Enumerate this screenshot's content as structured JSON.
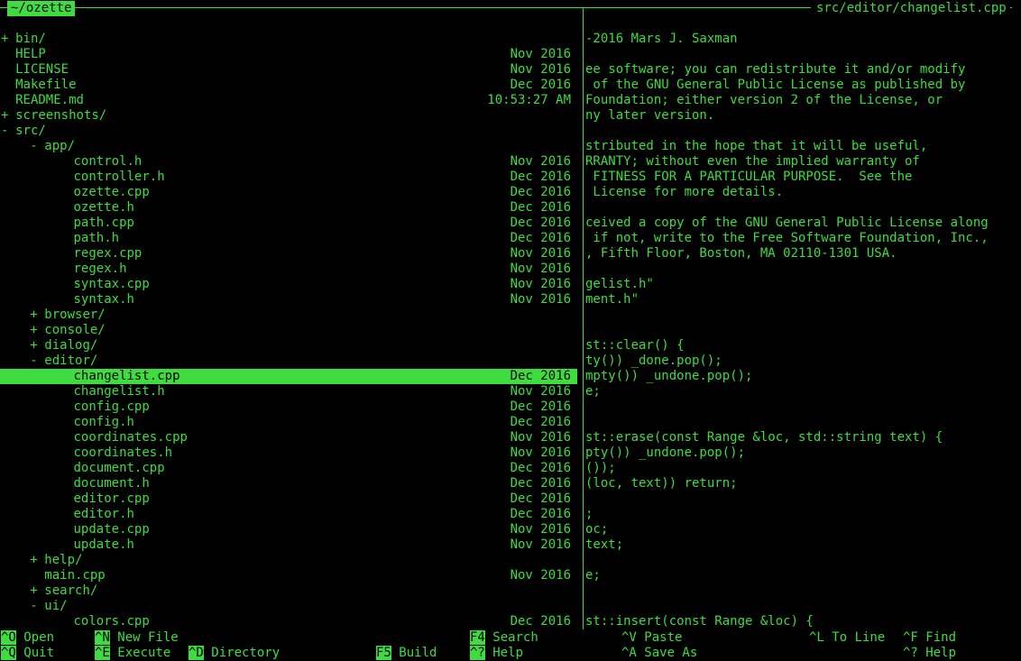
{
  "left_title": "~/ozette",
  "right_title": "src/editor/changelist.cpp",
  "tree": [
    {
      "mark": "+",
      "name": "bin/",
      "date": "",
      "depth": 0
    },
    {
      "mark": "",
      "name": "HELP",
      "date": "Nov 2016",
      "depth": 0
    },
    {
      "mark": "",
      "name": "LICENSE",
      "date": "Nov 2016",
      "depth": 0
    },
    {
      "mark": "",
      "name": "Makefile",
      "date": "Dec 2016",
      "depth": 0
    },
    {
      "mark": "",
      "name": "README.md",
      "date": "10:53:27 AM",
      "depth": 0
    },
    {
      "mark": "+",
      "name": "screenshots/",
      "date": "",
      "depth": 0
    },
    {
      "mark": "-",
      "name": "src/",
      "date": "",
      "depth": 0
    },
    {
      "mark": "-",
      "name": "app/",
      "date": "",
      "depth": 1
    },
    {
      "mark": "",
      "name": "control.h",
      "date": "Nov 2016",
      "depth": 2
    },
    {
      "mark": "",
      "name": "controller.h",
      "date": "Dec 2016",
      "depth": 2
    },
    {
      "mark": "",
      "name": "ozette.cpp",
      "date": "Dec 2016",
      "depth": 2
    },
    {
      "mark": "",
      "name": "ozette.h",
      "date": "Dec 2016",
      "depth": 2
    },
    {
      "mark": "",
      "name": "path.cpp",
      "date": "Dec 2016",
      "depth": 2
    },
    {
      "mark": "",
      "name": "path.h",
      "date": "Dec 2016",
      "depth": 2
    },
    {
      "mark": "",
      "name": "regex.cpp",
      "date": "Nov 2016",
      "depth": 2
    },
    {
      "mark": "",
      "name": "regex.h",
      "date": "Nov 2016",
      "depth": 2
    },
    {
      "mark": "",
      "name": "syntax.cpp",
      "date": "Nov 2016",
      "depth": 2
    },
    {
      "mark": "",
      "name": "syntax.h",
      "date": "Nov 2016",
      "depth": 2
    },
    {
      "mark": "+",
      "name": "browser/",
      "date": "",
      "depth": 1
    },
    {
      "mark": "+",
      "name": "console/",
      "date": "",
      "depth": 1
    },
    {
      "mark": "+",
      "name": "dialog/",
      "date": "",
      "depth": 1
    },
    {
      "mark": "-",
      "name": "editor/",
      "date": "",
      "depth": 1
    },
    {
      "mark": "",
      "name": "changelist.cpp",
      "date": "Dec 2016",
      "depth": 2,
      "selected": true
    },
    {
      "mark": "",
      "name": "changelist.h",
      "date": "Nov 2016",
      "depth": 2
    },
    {
      "mark": "",
      "name": "config.cpp",
      "date": "Dec 2016",
      "depth": 2
    },
    {
      "mark": "",
      "name": "config.h",
      "date": "Dec 2016",
      "depth": 2
    },
    {
      "mark": "",
      "name": "coordinates.cpp",
      "date": "Nov 2016",
      "depth": 2
    },
    {
      "mark": "",
      "name": "coordinates.h",
      "date": "Nov 2016",
      "depth": 2
    },
    {
      "mark": "",
      "name": "document.cpp",
      "date": "Dec 2016",
      "depth": 2
    },
    {
      "mark": "",
      "name": "document.h",
      "date": "Dec 2016",
      "depth": 2
    },
    {
      "mark": "",
      "name": "editor.cpp",
      "date": "Dec 2016",
      "depth": 2
    },
    {
      "mark": "",
      "name": "editor.h",
      "date": "Dec 2016",
      "depth": 2
    },
    {
      "mark": "",
      "name": "update.cpp",
      "date": "Nov 2016",
      "depth": 2
    },
    {
      "mark": "",
      "name": "update.h",
      "date": "Nov 2016",
      "depth": 2
    },
    {
      "mark": "+",
      "name": "help/",
      "date": "",
      "depth": 1
    },
    {
      "mark": "",
      "name": "main.cpp",
      "date": "Nov 2016",
      "depth": 1
    },
    {
      "mark": "+",
      "name": "search/",
      "date": "",
      "depth": 1
    },
    {
      "mark": "-",
      "name": "ui/",
      "date": "",
      "depth": 1
    },
    {
      "mark": "",
      "name": "colors.cpp",
      "date": "Dec 2016",
      "depth": 2
    }
  ],
  "code_lines": [
    "-2016 Mars J. Saxman",
    "",
    "ee software; you can redistribute it and/or modify",
    " of the GNU General Public License as published by",
    "Foundation; either version 2 of the License, or",
    "ny later version.",
    "",
    "stributed in the hope that it will be useful,",
    "RRANTY; without even the implied warranty of",
    " FITNESS FOR A PARTICULAR PURPOSE.  See the",
    " License for more details.",
    "",
    "ceived a copy of the GNU General Public License along",
    " if not, write to the Free Software Foundation, Inc.,",
    ", Fifth Floor, Boston, MA 02110-1301 USA.",
    "",
    "gelist.h\"",
    "ment.h\"",
    "",
    "",
    "st::clear() {",
    "ty()) _done.pop();",
    "mpty()) _undone.pop();",
    "e;",
    "",
    "",
    "st::erase(const Range &loc, std::string text) {",
    "pty()) _undone.pop();",
    "());",
    "(loc, text)) return;",
    "",
    ";",
    "oc;",
    "text;",
    "",
    "e;",
    "",
    "",
    "st::insert(const Range &loc) {"
  ],
  "left_keys": [
    {
      "key": "^O",
      "label": "Open"
    },
    {
      "key": "^N",
      "label": "New File"
    },
    {
      "key": "F4",
      "label": "Search"
    },
    {
      "key": "^Q",
      "label": "Quit"
    },
    {
      "key": "^E",
      "label": "Execute"
    },
    {
      "key": "^D",
      "label": "Directory"
    },
    {
      "key": "F5",
      "label": "Build"
    },
    {
      "key": "^?",
      "label": "Help"
    }
  ],
  "right_keys": [
    {
      "key": "^V",
      "label": "Paste"
    },
    {
      "key": "^L",
      "label": "To Line"
    },
    {
      "key": "^F",
      "label": "Find"
    },
    {
      "key": "^A",
      "label": "Save As"
    },
    {
      "key": "^?",
      "label": "Help"
    }
  ],
  "colors": {
    "fg": "#3fdc3f",
    "bg": "#000000"
  }
}
